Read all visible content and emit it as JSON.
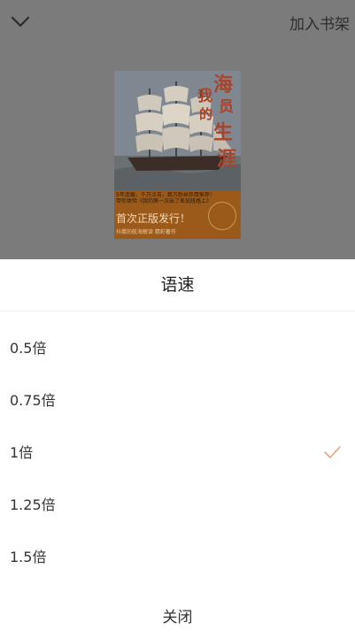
{
  "header": {
    "collapse_icon": "chevron-down-icon",
    "add_to_shelf": "加入书架"
  },
  "book": {
    "cover": {
      "title_chars": [
        "海",
        "员",
        "生",
        "涯"
      ],
      "title_left_chars": [
        "我",
        "的"
      ],
      "blurb_line1": "5年连载，千万点击，数万粉丝热情推荐！",
      "blurb_line2": "带你体验《我的第一次出了差加班路上》",
      "first_release": "首次正版发行！",
      "subtitle": "抖擞的航海解读 精彩著作"
    }
  },
  "speed_sheet": {
    "title": "语速",
    "options": [
      {
        "label": "0.5倍",
        "selected": false
      },
      {
        "label": "0.75倍",
        "selected": false
      },
      {
        "label": "1倍",
        "selected": true
      },
      {
        "label": "1.25倍",
        "selected": false
      },
      {
        "label": "1.5倍",
        "selected": false
      }
    ],
    "close_label": "关闭"
  },
  "colors": {
    "backdrop": "#7b7b7b",
    "check": "#f0a07a",
    "text": "#333333"
  }
}
